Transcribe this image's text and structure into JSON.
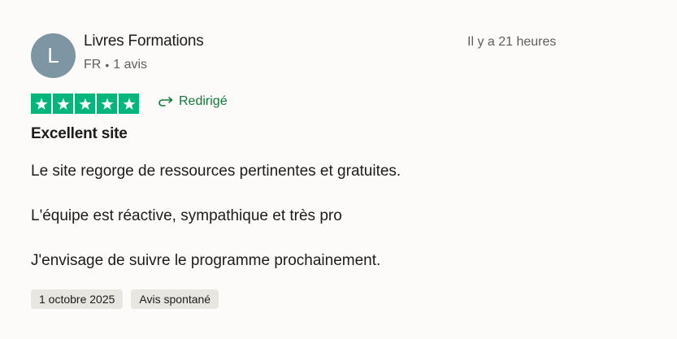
{
  "review": {
    "avatar_initial": "L",
    "avatar_color": "#7e96a3",
    "reviewer_name": "Livres Formations",
    "country": "FR",
    "separator": "•",
    "review_count": "1 avis",
    "time_ago": "Il y a 21 heures",
    "rating": 5,
    "rating_max": 5,
    "star_color": "#00b67a",
    "star_icon": "star-icon",
    "redirect_icon": "redirect-arrow-icon",
    "redirect_label": "Redirigé",
    "title": "Excellent site",
    "body": [
      "Le site regorge de ressources pertinentes et gratuites.",
      "L'équipe est réactive, sympathique et très pro",
      "J'envisage de suivre le programme prochainement."
    ],
    "tags": [
      "1 octobre 2025",
      "Avis spontané"
    ]
  }
}
